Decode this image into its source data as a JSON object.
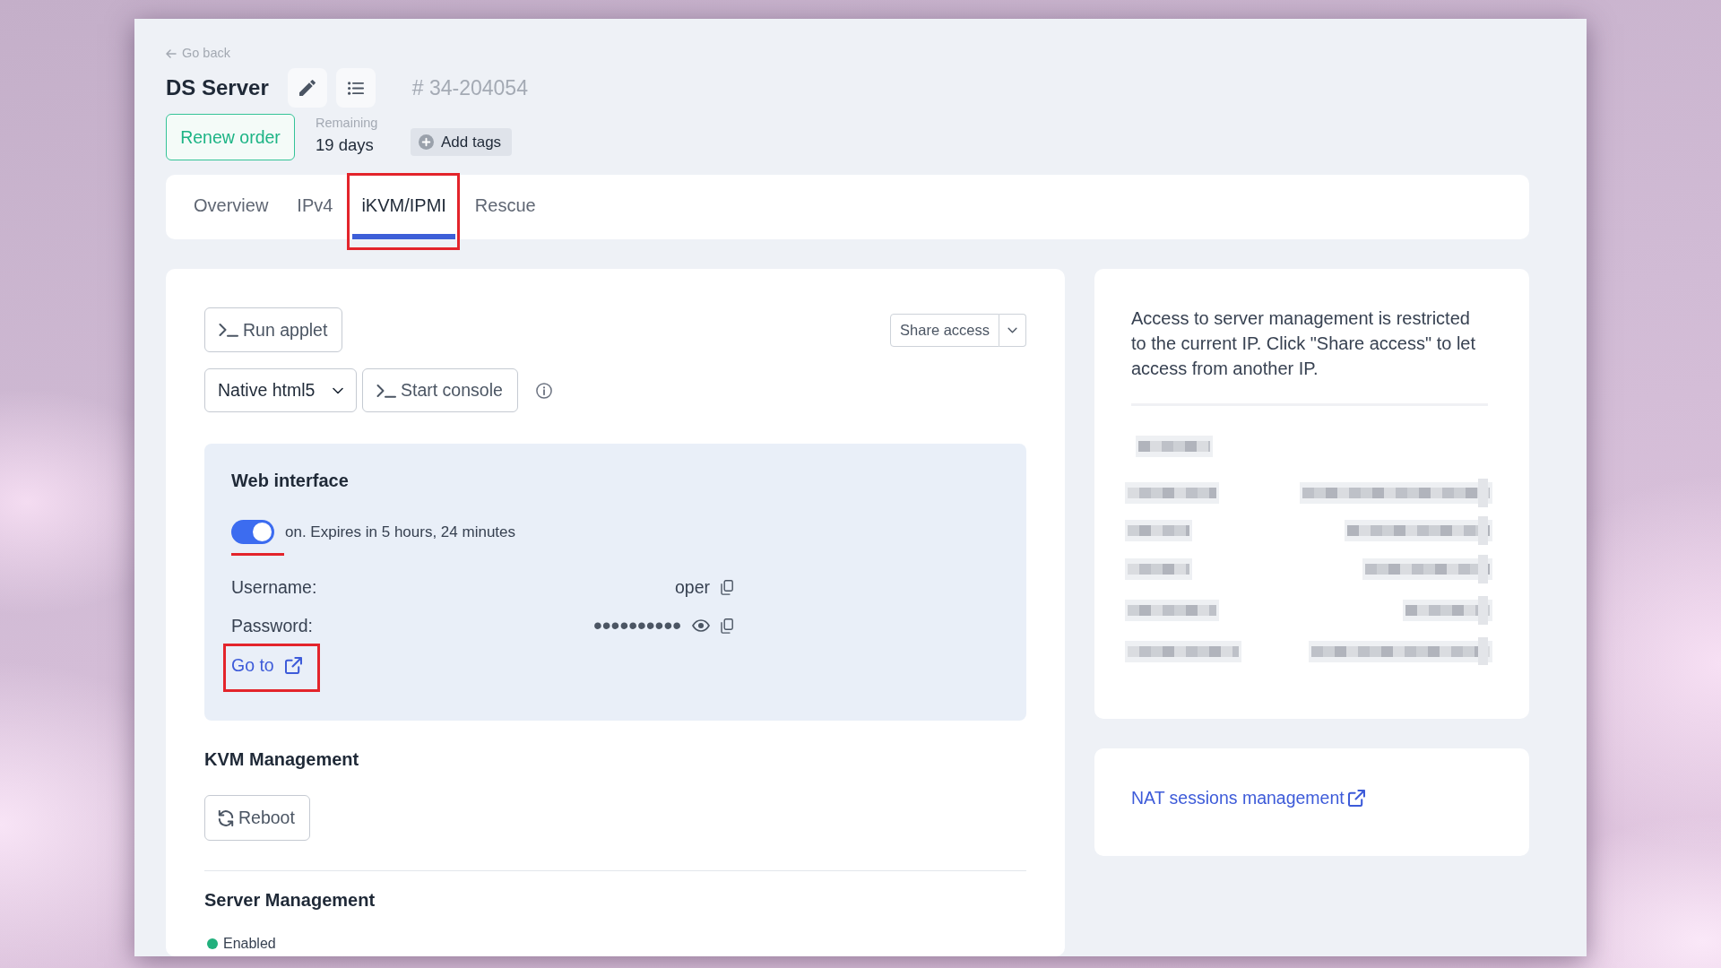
{
  "header": {
    "back_link": "Go back",
    "title": "DS Server",
    "order_number": "# 34-204054",
    "renew_button": "Renew order",
    "remaining": {
      "label": "Remaining",
      "value": "19 days"
    },
    "add_tags_button": "Add tags"
  },
  "tabs": [
    {
      "label": "Overview",
      "selected": false,
      "annotated": false
    },
    {
      "label": "IPv4",
      "selected": false,
      "annotated": false
    },
    {
      "label": "iKVM/IPMI",
      "selected": true,
      "annotated": true
    },
    {
      "label": "Rescue",
      "selected": false,
      "annotated": false
    }
  ],
  "console": {
    "run_applet_button": "Run applet",
    "share_access_button": "Share access",
    "viewer_select": "Native html5",
    "start_console_button": "Start console"
  },
  "web_interface": {
    "title": "Web interface",
    "toggle": {
      "on": true,
      "annotated": true,
      "status": "on. Expires in 5 hours, 24 minutes"
    },
    "credentials": [
      {
        "kind": "plain",
        "label": "Username:",
        "value": "oper"
      },
      {
        "kind": "secret",
        "label": "Password:",
        "value": "••••••••••"
      }
    ],
    "go_to_link": {
      "label": "Go to",
      "annotated": true
    }
  },
  "kvm_management": {
    "title": "KVM Management",
    "reboot_button": "Reboot"
  },
  "server_management": {
    "title": "Server Management",
    "status": {
      "label": "Enabled",
      "color": "#22b07d"
    }
  },
  "access_card": {
    "notice": "Access to server management is restricted to the current IP. Click \"Share access\" to let access from another IP."
  },
  "nat_card": {
    "link": "NAT sessions management"
  }
}
